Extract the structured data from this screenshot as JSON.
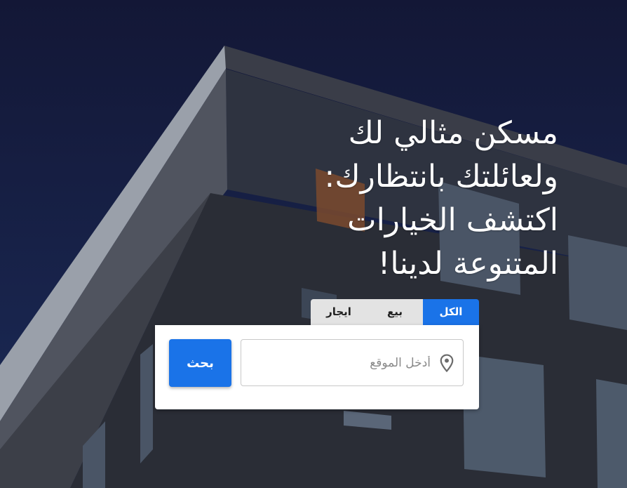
{
  "hero": {
    "headline_lines": [
      "مسكن مثالي لك",
      "ولعائلتك بانتظارك:",
      "اكتشف الخيارات",
      "المتنوعة لدينا!"
    ]
  },
  "search": {
    "tabs": [
      {
        "label": "الكل",
        "active": true
      },
      {
        "label": "بيع",
        "active": false
      },
      {
        "label": "ايجار",
        "active": false
      }
    ],
    "location_placeholder": "أدخل الموقع",
    "location_icon": "map-pin-icon",
    "button_label": "بحث"
  },
  "colors": {
    "accent": "#1a73e8",
    "sky": "#15234c",
    "tab_inactive": "#e3e3e3"
  }
}
